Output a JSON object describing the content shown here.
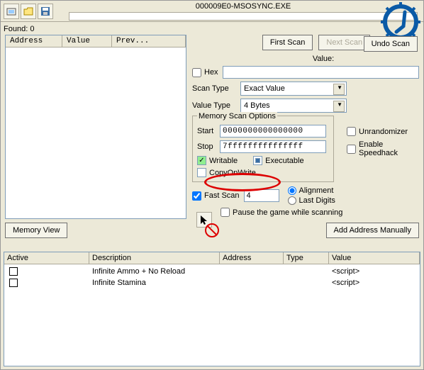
{
  "toolbar": {
    "process_name": "000009E0-MSOSYNC.EXE"
  },
  "logo_label": "Settings",
  "found_label": "Found:",
  "found_count": 0,
  "results_header": {
    "address": "Address",
    "value": "Value",
    "prev": "Prev..."
  },
  "scan": {
    "first": "First Scan",
    "next": "Next Scan",
    "undo": "Undo Scan",
    "value_label": "Value:",
    "hex_label": "Hex",
    "scantype_label": "Scan Type",
    "scantype_value": "Exact Value",
    "valuetype_label": "Value Type",
    "valuetype_value": "4 Bytes"
  },
  "mem": {
    "title": "Memory Scan Options",
    "start_label": "Start",
    "start_value": "0000000000000000",
    "stop_label": "Stop",
    "stop_value": "7fffffffffffffff",
    "writable": "Writable",
    "executable": "Executable",
    "copyonwrite": "CopyOnWrite"
  },
  "fastscan": {
    "label": "Fast Scan",
    "value": "4",
    "alignment": "Alignment",
    "last_digits": "Last Digits"
  },
  "pause_label": "Pause the game while scanning",
  "right": {
    "unrandomizer": "Unrandomizer",
    "speedhack": "Enable Speedhack"
  },
  "bottom": {
    "memory_view": "Memory View",
    "add_manual": "Add Address Manually"
  },
  "table": {
    "headers": {
      "active": "Active",
      "description": "Description",
      "address": "Address",
      "type": "Type",
      "value": "Value"
    },
    "rows": [
      {
        "active": false,
        "description": "Infinite Ammo + No Reload",
        "address": "",
        "type": "",
        "value": "<script>"
      },
      {
        "active": false,
        "description": "Infinite Stamina",
        "address": "",
        "type": "",
        "value": "<script>"
      }
    ]
  }
}
